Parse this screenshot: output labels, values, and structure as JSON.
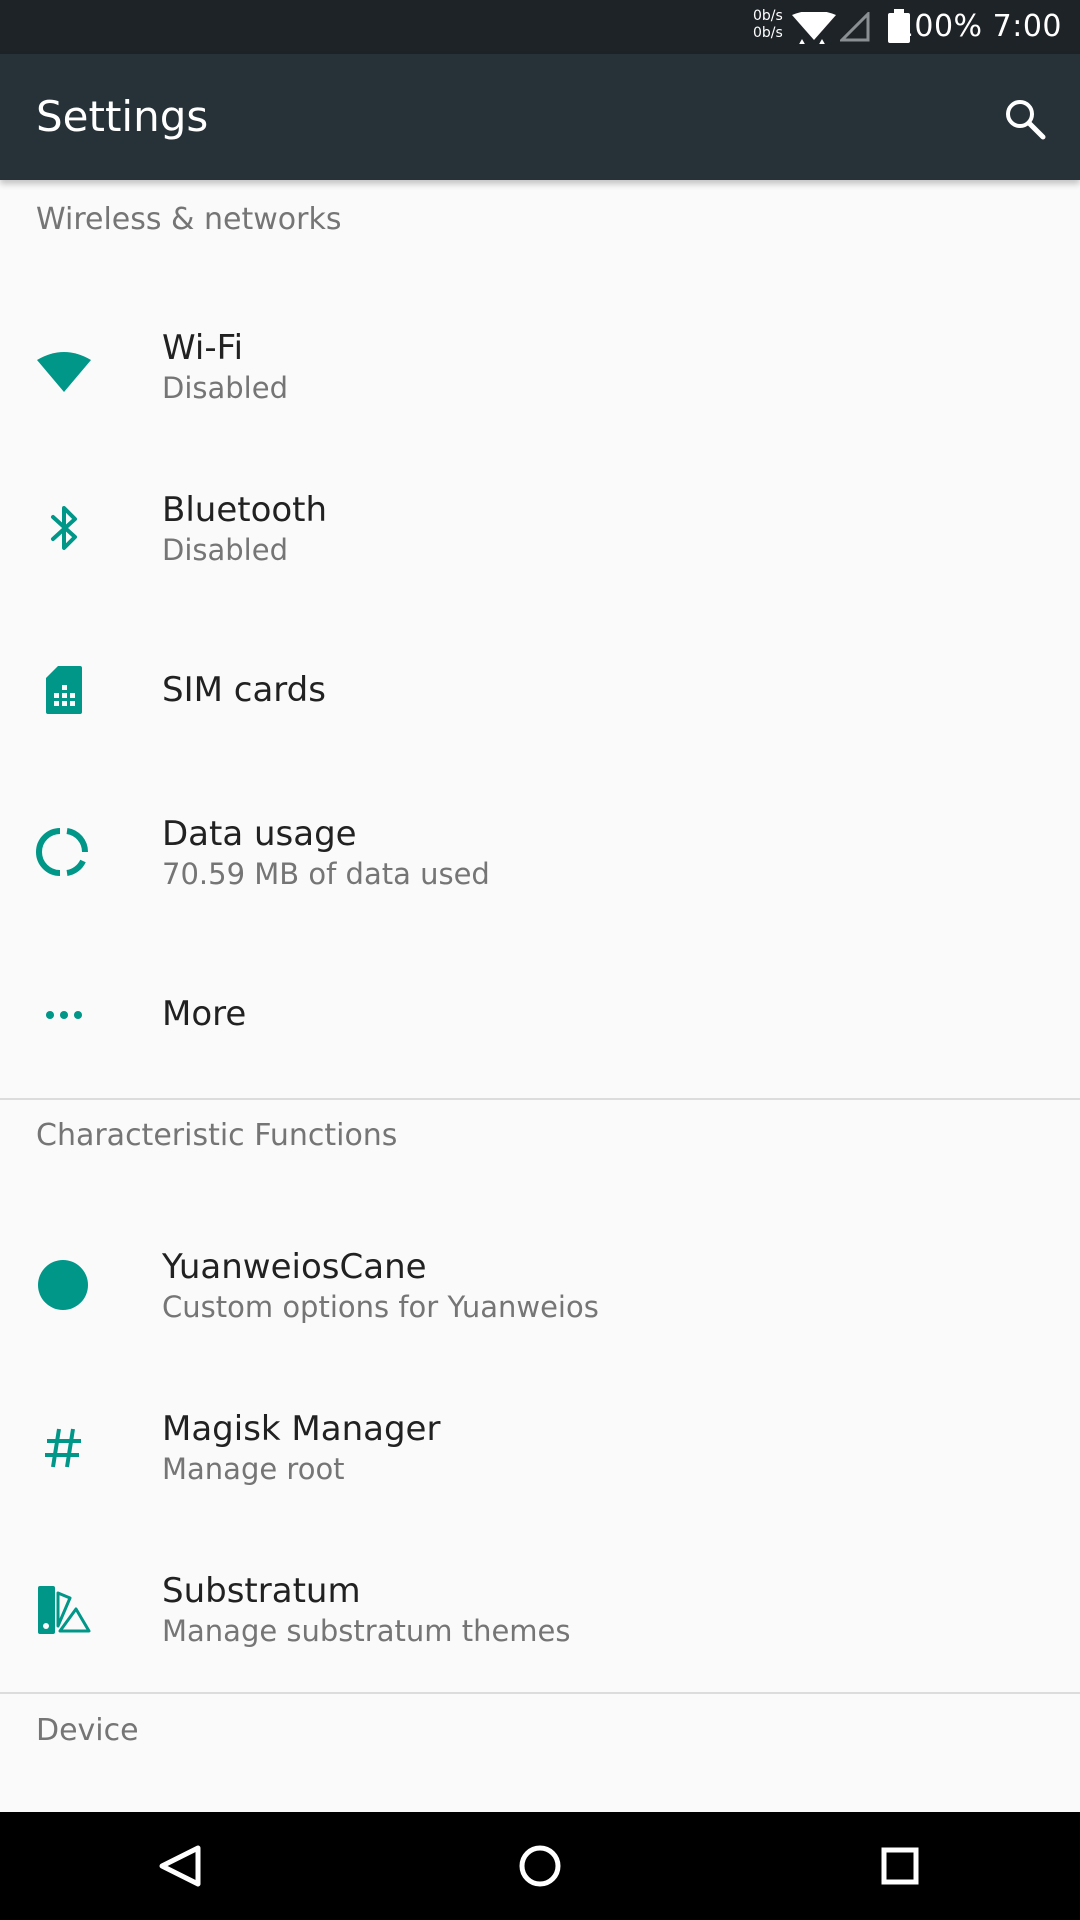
{
  "status_bar": {
    "net_up": "0b/s",
    "net_down": "0b/s",
    "battery": "100%",
    "time": "7:00",
    "icons": [
      "wifi-icon",
      "signal-icon",
      "battery-icon"
    ]
  },
  "toolbar": {
    "title": "Settings",
    "search_icon": "search-icon"
  },
  "sections": [
    {
      "header": "Wireless & networks",
      "items": [
        {
          "icon": "wifi-icon",
          "title": "Wi-Fi",
          "summary": "Disabled"
        },
        {
          "icon": "bluetooth-icon",
          "title": "Bluetooth",
          "summary": "Disabled"
        },
        {
          "icon": "sim-card-icon",
          "title": "SIM cards",
          "summary": ""
        },
        {
          "icon": "data-usage-icon",
          "title": "Data usage",
          "summary": "70.59 MB of data used"
        },
        {
          "icon": "more-icon",
          "title": "More",
          "summary": ""
        }
      ]
    },
    {
      "header": "Characteristic Functions",
      "items": [
        {
          "icon": "circle-icon",
          "title": "YuanweiosCane",
          "summary": "Custom options for Yuanweios"
        },
        {
          "icon": "hash-icon",
          "title": "Magisk Manager",
          "summary": "Manage root"
        },
        {
          "icon": "substratum-icon",
          "title": "Substratum",
          "summary": "Manage substratum themes"
        }
      ]
    },
    {
      "header": "Device",
      "items": []
    }
  ],
  "nav_bar": {
    "back_icon": "back-icon",
    "home_icon": "home-icon",
    "recents_icon": "recents-icon"
  },
  "colors": {
    "accent": "#009688",
    "toolbar": "#263238",
    "status_bar": "#1e2327",
    "background": "#fafafa"
  }
}
